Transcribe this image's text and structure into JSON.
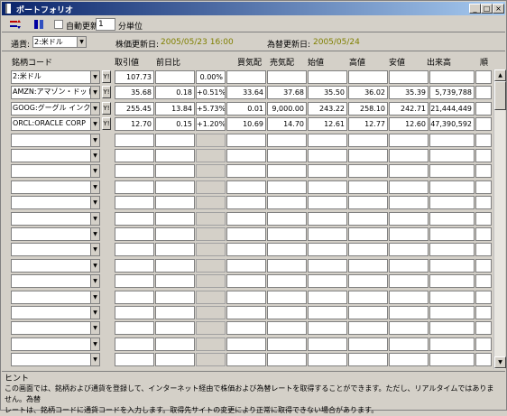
{
  "window": {
    "title": "ポートフォリオ",
    "minimize": "_",
    "maximize": "□",
    "close": "×"
  },
  "toolbar": {
    "auto_update_label": "自動更新",
    "interval_value": "1",
    "interval_unit": "分単位"
  },
  "selectors": {
    "currency_label": "通貨:",
    "currency_value": "2:米ドル",
    "stock_updated_label": "株価更新日:",
    "stock_updated_value": "2005/05/23 16:00",
    "fx_updated_label": "為替更新日:",
    "fx_updated_value": "2005/05/24"
  },
  "columns": [
    "銘柄コード",
    "取引値",
    "前日比",
    "買気配",
    "売気配",
    "始値",
    "高値",
    "安値",
    "出来高",
    "順"
  ],
  "rows": [
    {
      "code": "2:米ドル",
      "price": "107.73",
      "change": "",
      "pct": "0.00%",
      "bid": "",
      "ask": "",
      "open": "",
      "high": "",
      "low": "",
      "volume": ""
    },
    {
      "code": "AMZN:アマゾン・ドット",
      "price": "35.68",
      "change": "0.18",
      "pct": "+0.51%",
      "bid": "33.64",
      "ask": "37.68",
      "open": "35.50",
      "high": "36.02",
      "low": "35.39",
      "volume": "5,739,788"
    },
    {
      "code": "GOOG:グーグル インク",
      "price": "255.45",
      "change": "13.84",
      "pct": "+5.73%",
      "bid": "0.01",
      "ask": "9,000.00",
      "open": "243.22",
      "high": "258.10",
      "low": "242.71",
      "volume": "21,444,449"
    },
    {
      "code": "ORCL:ORACLE CORP",
      "price": "12.70",
      "change": "0.15",
      "pct": "+1.20%",
      "bid": "10.69",
      "ask": "14.70",
      "open": "12.61",
      "high": "12.77",
      "low": "12.60",
      "volume": "47,390,592"
    }
  ],
  "hint": {
    "title": "ヒント",
    "body": "この画面では、銘柄および通貨を登録して、インターネット経由で株価および為替レートを取得することができます。ただし、リアルタイムではありません。為替\nレートは、銘柄コードに通貨コードを入力します。取得先サイトの変更により正常に取得できない場合があります。"
  },
  "y_button": "Y!"
}
